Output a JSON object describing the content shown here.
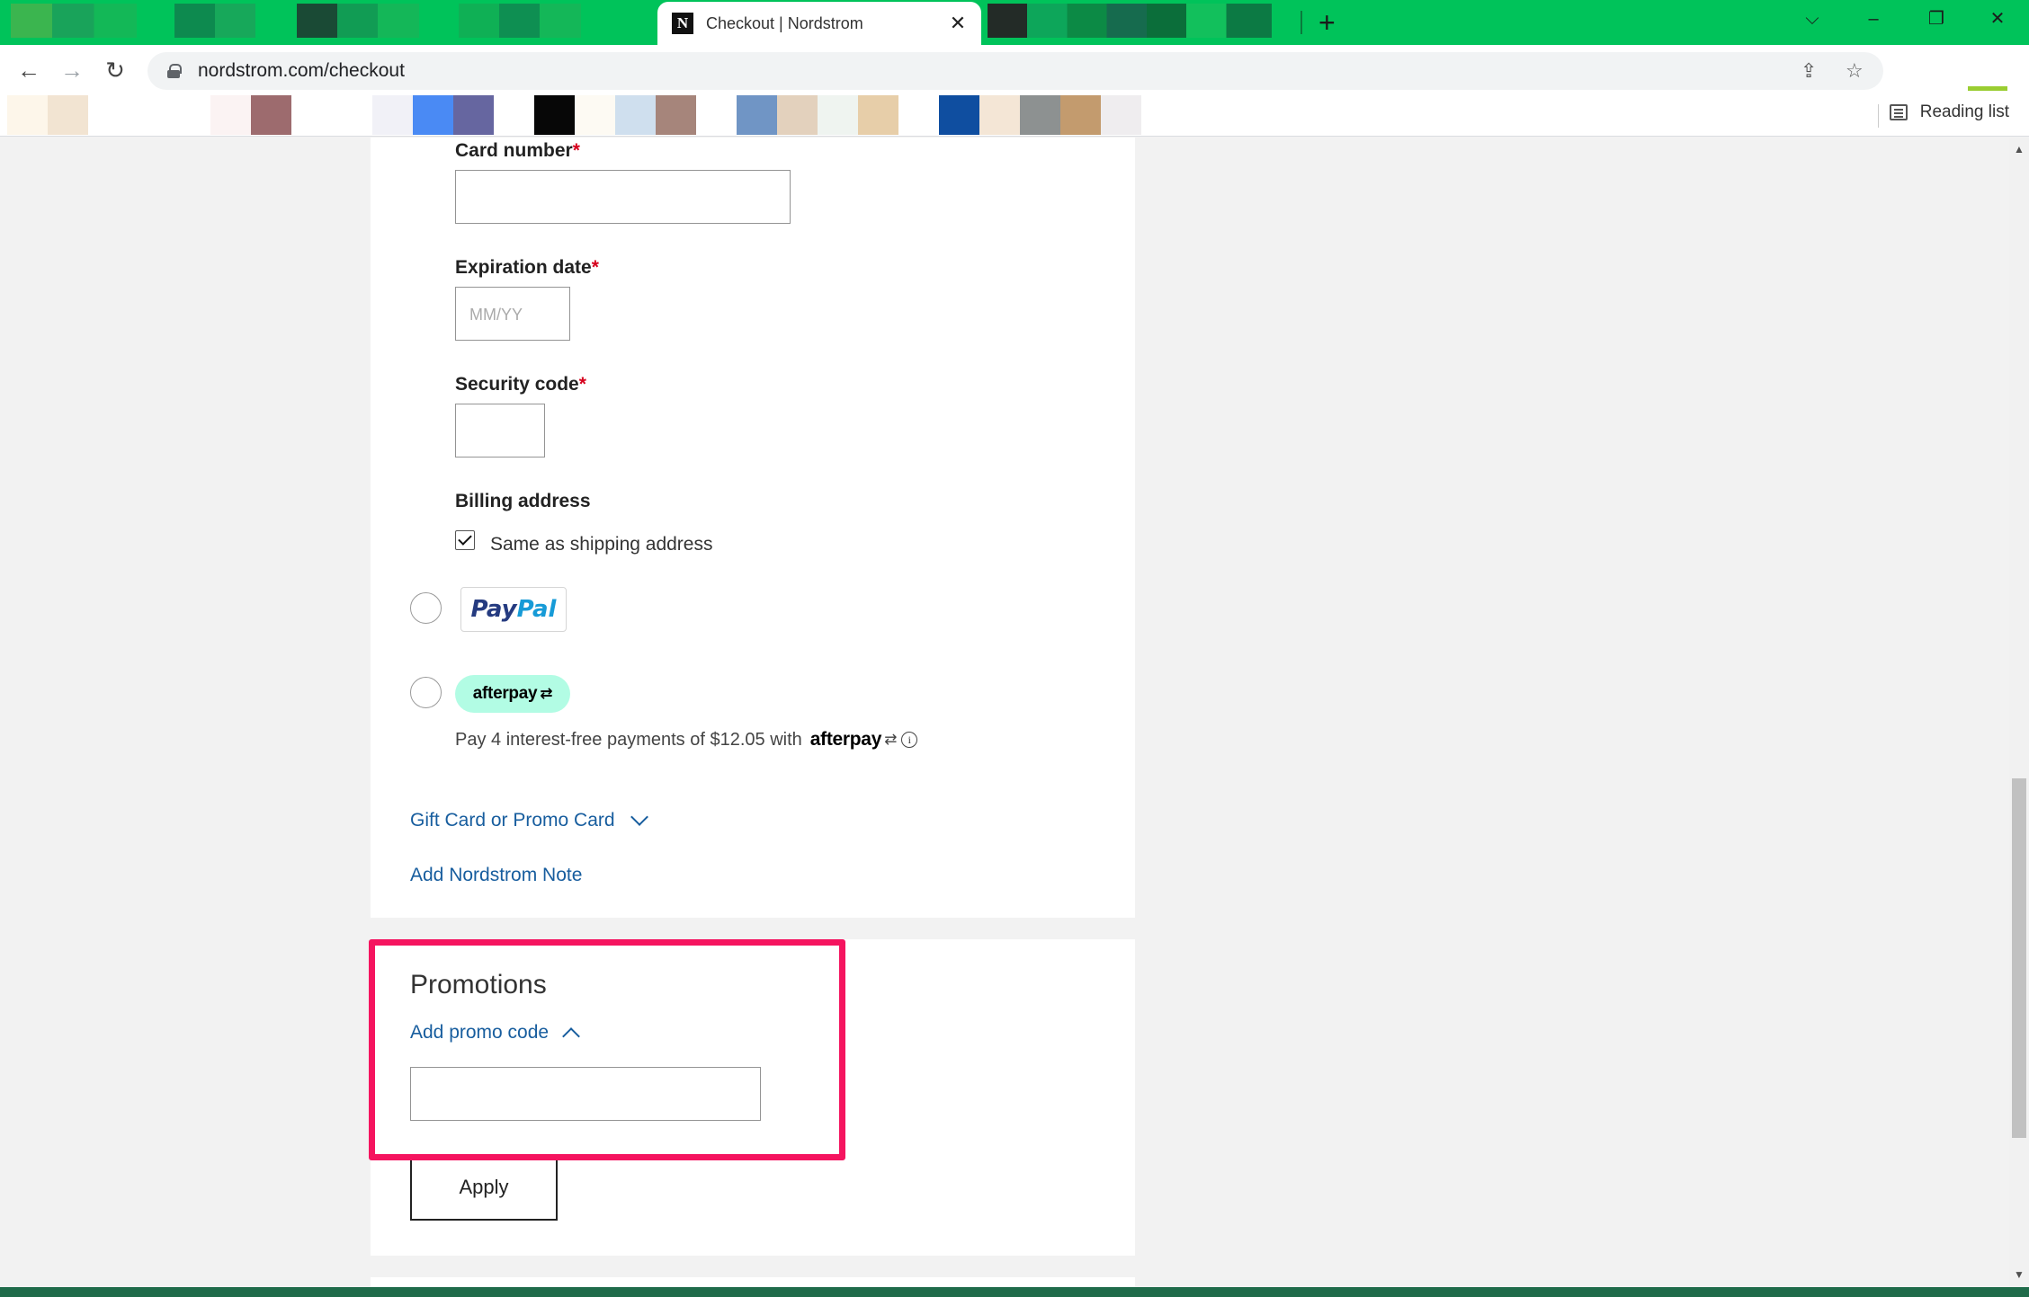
{
  "browser": {
    "active_tab_title": "Checkout | Nordstrom",
    "favicon_letter": "N",
    "tab_close": "✕",
    "new_tab": "+",
    "url": "nordstrom.com/checkout",
    "reading_list": "Reading list"
  },
  "payment": {
    "card_number_label": "Card number",
    "expiration_label": "Expiration date",
    "expiration_placeholder": "MM/YY",
    "security_label": "Security code",
    "required_mark": "*",
    "billing_label": "Billing address",
    "same_as_shipping": "Same as shipping address",
    "same_as_shipping_checked": true,
    "paypal_part1": "Pay",
    "paypal_part2": "Pal",
    "afterpay_badge": "afterpay",
    "afterpay_arrows": "⇄",
    "afterpay_text": "Pay 4 interest-free payments of $12.05 with",
    "afterpay_inline": "afterpay",
    "info_glyph": "i",
    "gift_card_link": "Gift Card or Promo Card",
    "note_link": "Add Nordstrom Note"
  },
  "promotions": {
    "title": "Promotions",
    "add_promo_link": "Add promo code",
    "apply_button": "Apply"
  },
  "colors": {
    "tab_strip": "#00c35a",
    "link": "#175d9e",
    "highlight": "#f5145f",
    "required": "#d6001c"
  }
}
